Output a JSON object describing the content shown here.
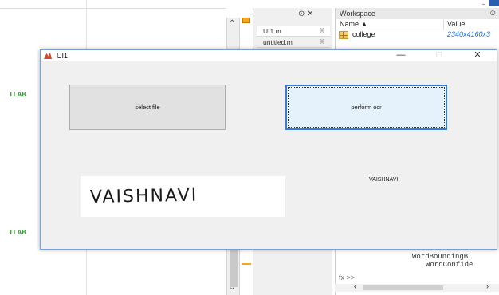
{
  "background": {
    "tlab_top": "TLAB",
    "tlab_bottom": "TLAB",
    "editor_tabs": [
      {
        "label": "UI1.m",
        "close": "⌘"
      },
      {
        "label": "untitled.m",
        "close": "⌘"
      }
    ],
    "tab_controls": "⊙ ✕",
    "top_right_text": "-",
    "workspace": {
      "title": "Workspace",
      "col_name": "Name ▲",
      "col_value": "Value",
      "variables": [
        {
          "name": "college",
          "value": "2340x4160x3"
        }
      ]
    },
    "command_lines": [
      "WordBoundingB",
      "WordConfide"
    ],
    "prompt": "fx >>"
  },
  "window": {
    "title": "UI1",
    "minimize": "—",
    "maximize": "□",
    "close": "✕"
  },
  "buttons": {
    "select_file": "select file",
    "perform_ocr": "perform ocr"
  },
  "image_text": "VAISHNAVI",
  "ocr_result": "VAISHNAVI"
}
